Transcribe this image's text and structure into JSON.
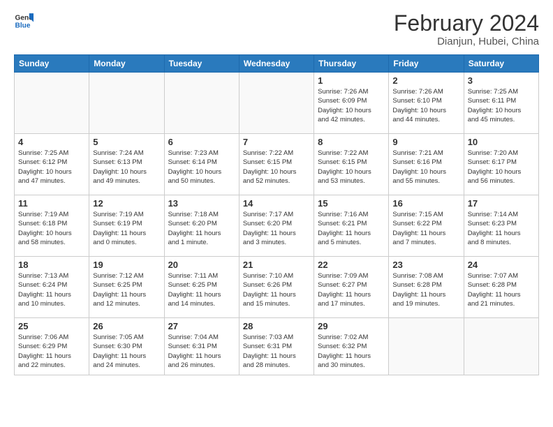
{
  "header": {
    "logo_line1": "General",
    "logo_line2": "Blue",
    "main_title": "February 2024",
    "subtitle": "Dianjun, Hubei, China"
  },
  "columns": [
    "Sunday",
    "Monday",
    "Tuesday",
    "Wednesday",
    "Thursday",
    "Friday",
    "Saturday"
  ],
  "weeks": [
    [
      {
        "num": "",
        "info": ""
      },
      {
        "num": "",
        "info": ""
      },
      {
        "num": "",
        "info": ""
      },
      {
        "num": "",
        "info": ""
      },
      {
        "num": "1",
        "info": "Sunrise: 7:26 AM\nSunset: 6:09 PM\nDaylight: 10 hours\nand 42 minutes."
      },
      {
        "num": "2",
        "info": "Sunrise: 7:26 AM\nSunset: 6:10 PM\nDaylight: 10 hours\nand 44 minutes."
      },
      {
        "num": "3",
        "info": "Sunrise: 7:25 AM\nSunset: 6:11 PM\nDaylight: 10 hours\nand 45 minutes."
      }
    ],
    [
      {
        "num": "4",
        "info": "Sunrise: 7:25 AM\nSunset: 6:12 PM\nDaylight: 10 hours\nand 47 minutes."
      },
      {
        "num": "5",
        "info": "Sunrise: 7:24 AM\nSunset: 6:13 PM\nDaylight: 10 hours\nand 49 minutes."
      },
      {
        "num": "6",
        "info": "Sunrise: 7:23 AM\nSunset: 6:14 PM\nDaylight: 10 hours\nand 50 minutes."
      },
      {
        "num": "7",
        "info": "Sunrise: 7:22 AM\nSunset: 6:15 PM\nDaylight: 10 hours\nand 52 minutes."
      },
      {
        "num": "8",
        "info": "Sunrise: 7:22 AM\nSunset: 6:15 PM\nDaylight: 10 hours\nand 53 minutes."
      },
      {
        "num": "9",
        "info": "Sunrise: 7:21 AM\nSunset: 6:16 PM\nDaylight: 10 hours\nand 55 minutes."
      },
      {
        "num": "10",
        "info": "Sunrise: 7:20 AM\nSunset: 6:17 PM\nDaylight: 10 hours\nand 56 minutes."
      }
    ],
    [
      {
        "num": "11",
        "info": "Sunrise: 7:19 AM\nSunset: 6:18 PM\nDaylight: 10 hours\nand 58 minutes."
      },
      {
        "num": "12",
        "info": "Sunrise: 7:19 AM\nSunset: 6:19 PM\nDaylight: 11 hours\nand 0 minutes."
      },
      {
        "num": "13",
        "info": "Sunrise: 7:18 AM\nSunset: 6:20 PM\nDaylight: 11 hours\nand 1 minute."
      },
      {
        "num": "14",
        "info": "Sunrise: 7:17 AM\nSunset: 6:20 PM\nDaylight: 11 hours\nand 3 minutes."
      },
      {
        "num": "15",
        "info": "Sunrise: 7:16 AM\nSunset: 6:21 PM\nDaylight: 11 hours\nand 5 minutes."
      },
      {
        "num": "16",
        "info": "Sunrise: 7:15 AM\nSunset: 6:22 PM\nDaylight: 11 hours\nand 7 minutes."
      },
      {
        "num": "17",
        "info": "Sunrise: 7:14 AM\nSunset: 6:23 PM\nDaylight: 11 hours\nand 8 minutes."
      }
    ],
    [
      {
        "num": "18",
        "info": "Sunrise: 7:13 AM\nSunset: 6:24 PM\nDaylight: 11 hours\nand 10 minutes."
      },
      {
        "num": "19",
        "info": "Sunrise: 7:12 AM\nSunset: 6:25 PM\nDaylight: 11 hours\nand 12 minutes."
      },
      {
        "num": "20",
        "info": "Sunrise: 7:11 AM\nSunset: 6:25 PM\nDaylight: 11 hours\nand 14 minutes."
      },
      {
        "num": "21",
        "info": "Sunrise: 7:10 AM\nSunset: 6:26 PM\nDaylight: 11 hours\nand 15 minutes."
      },
      {
        "num": "22",
        "info": "Sunrise: 7:09 AM\nSunset: 6:27 PM\nDaylight: 11 hours\nand 17 minutes."
      },
      {
        "num": "23",
        "info": "Sunrise: 7:08 AM\nSunset: 6:28 PM\nDaylight: 11 hours\nand 19 minutes."
      },
      {
        "num": "24",
        "info": "Sunrise: 7:07 AM\nSunset: 6:28 PM\nDaylight: 11 hours\nand 21 minutes."
      }
    ],
    [
      {
        "num": "25",
        "info": "Sunrise: 7:06 AM\nSunset: 6:29 PM\nDaylight: 11 hours\nand 22 minutes."
      },
      {
        "num": "26",
        "info": "Sunrise: 7:05 AM\nSunset: 6:30 PM\nDaylight: 11 hours\nand 24 minutes."
      },
      {
        "num": "27",
        "info": "Sunrise: 7:04 AM\nSunset: 6:31 PM\nDaylight: 11 hours\nand 26 minutes."
      },
      {
        "num": "28",
        "info": "Sunrise: 7:03 AM\nSunset: 6:31 PM\nDaylight: 11 hours\nand 28 minutes."
      },
      {
        "num": "29",
        "info": "Sunrise: 7:02 AM\nSunset: 6:32 PM\nDaylight: 11 hours\nand 30 minutes."
      },
      {
        "num": "",
        "info": ""
      },
      {
        "num": "",
        "info": ""
      }
    ]
  ]
}
